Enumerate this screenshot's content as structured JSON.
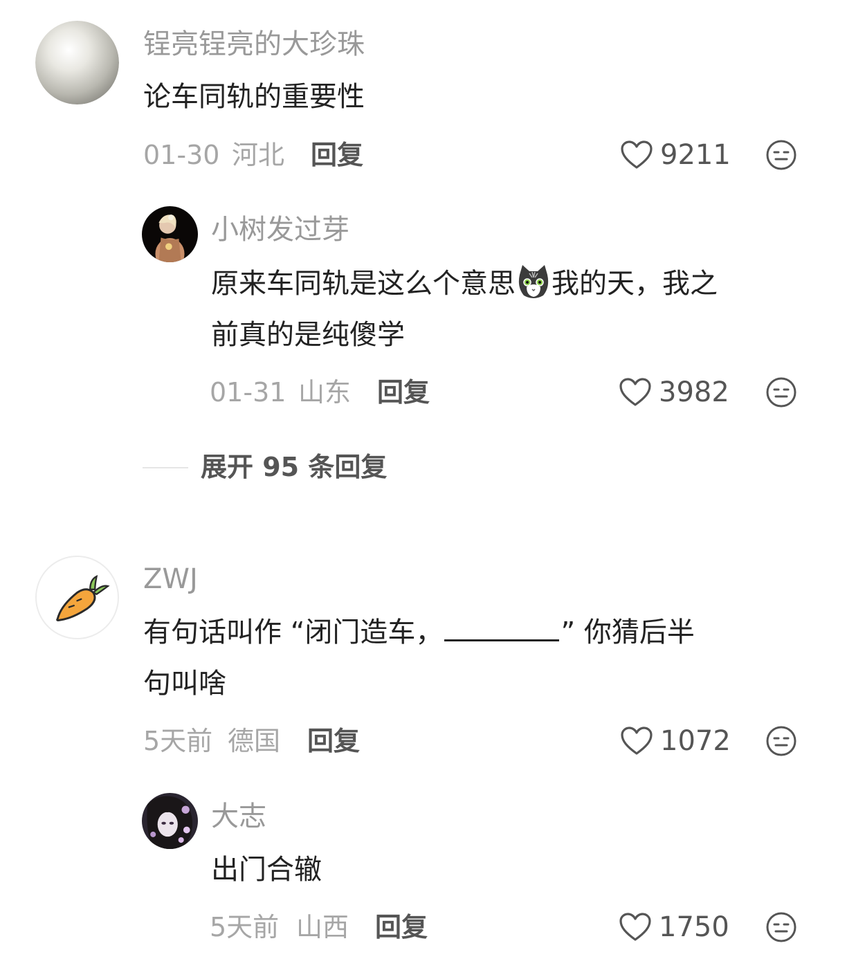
{
  "comments": [
    {
      "username": "锃亮锃亮的大珍珠",
      "avatar_icon": "pearl-avatar",
      "text_lines": [
        "论车同轨的重要性"
      ],
      "date": "01-30",
      "location": "河北",
      "reply_label": "回复",
      "likes": "9211",
      "replies": [
        {
          "username": "小树发过芽",
          "avatar_icon": "portrait-avatar",
          "text_line1_before": "原来车同轨是这么个意思",
          "emoji_icon": "cat-emoji-icon",
          "text_line1_after": "我的天，我之",
          "text_line2": "前真的是纯傻学",
          "date": "01-31",
          "location": "山东",
          "reply_label": "回复",
          "likes": "3982"
        }
      ],
      "expand_label": "展开 95 条回复"
    },
    {
      "username": "ZWJ",
      "avatar_icon": "carrot-avatar",
      "text_line1_before": "有句话叫作 “闭门造车，",
      "text_line1_after": "” 你猜后半",
      "text_line2": "句叫啥",
      "date": "5天前",
      "location": "德国",
      "reply_label": "回复",
      "likes": "1072",
      "replies": [
        {
          "username": "大志",
          "avatar_icon": "illustrated-girl-avatar",
          "text_lines": [
            "出门合辙"
          ],
          "date": "5天前",
          "location": "山西",
          "reply_label": "回复",
          "likes": "1750"
        }
      ]
    }
  ],
  "colors": {
    "username": "#999999",
    "content": "#222222",
    "meta": "#a6a6a6",
    "action": "#555555"
  }
}
